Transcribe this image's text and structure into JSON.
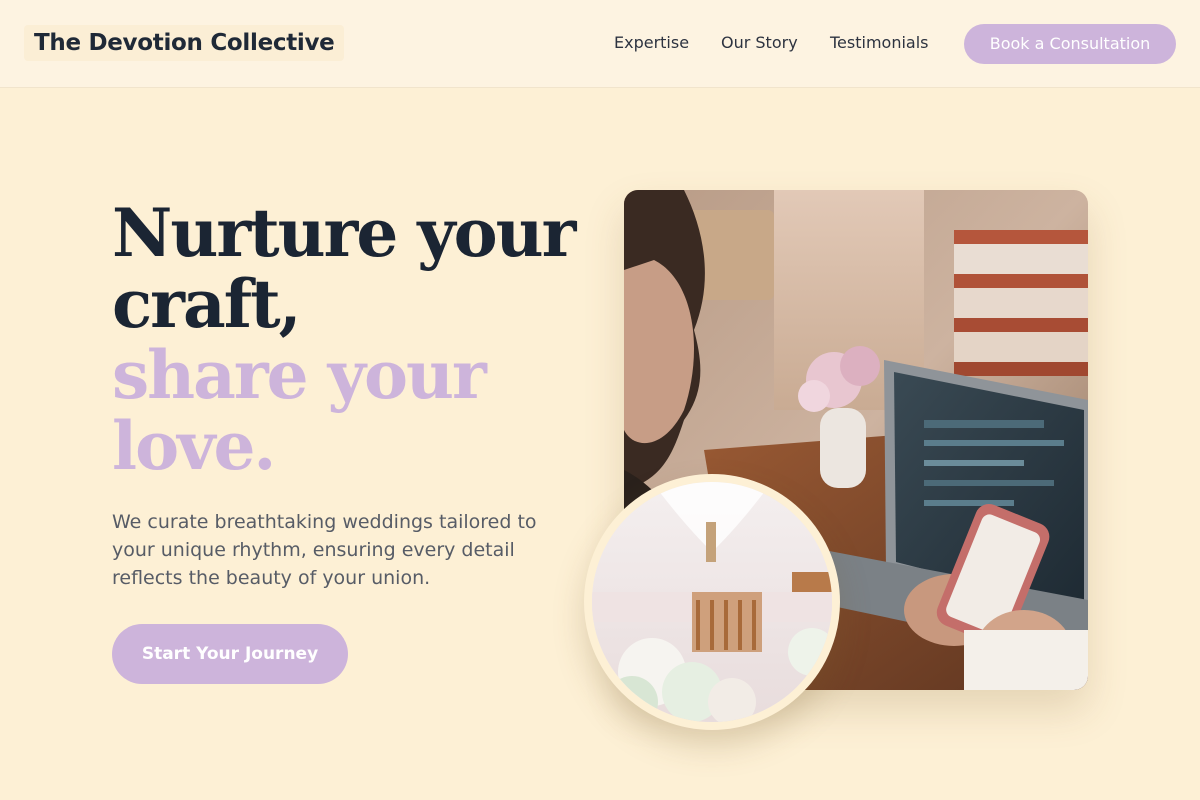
{
  "header": {
    "brand": "The Devotion Collective",
    "nav": [
      {
        "label": "Expertise"
      },
      {
        "label": "Our Story"
      },
      {
        "label": "Testimonials"
      }
    ],
    "cta_label": "Book a Consultation"
  },
  "hero": {
    "headline_line1": "Nurture your",
    "headline_line2": "craft,",
    "headline_line3": "share your",
    "headline_line4": "love.",
    "lede": "We curate breathtaking weddings tailored to your unique rhythm, ensuring every detail reflects the beauty of your union.",
    "cta_label": "Start Your Journey"
  },
  "colors": {
    "background": "#fdf0d5",
    "accent": "#cdb4db",
    "heading": "#1b2533",
    "body_text": "#575c66"
  },
  "images": {
    "main_photo": "woman-with-laptop-and-phone-photo",
    "circle_photo": "wedding-table-setting-photo"
  }
}
